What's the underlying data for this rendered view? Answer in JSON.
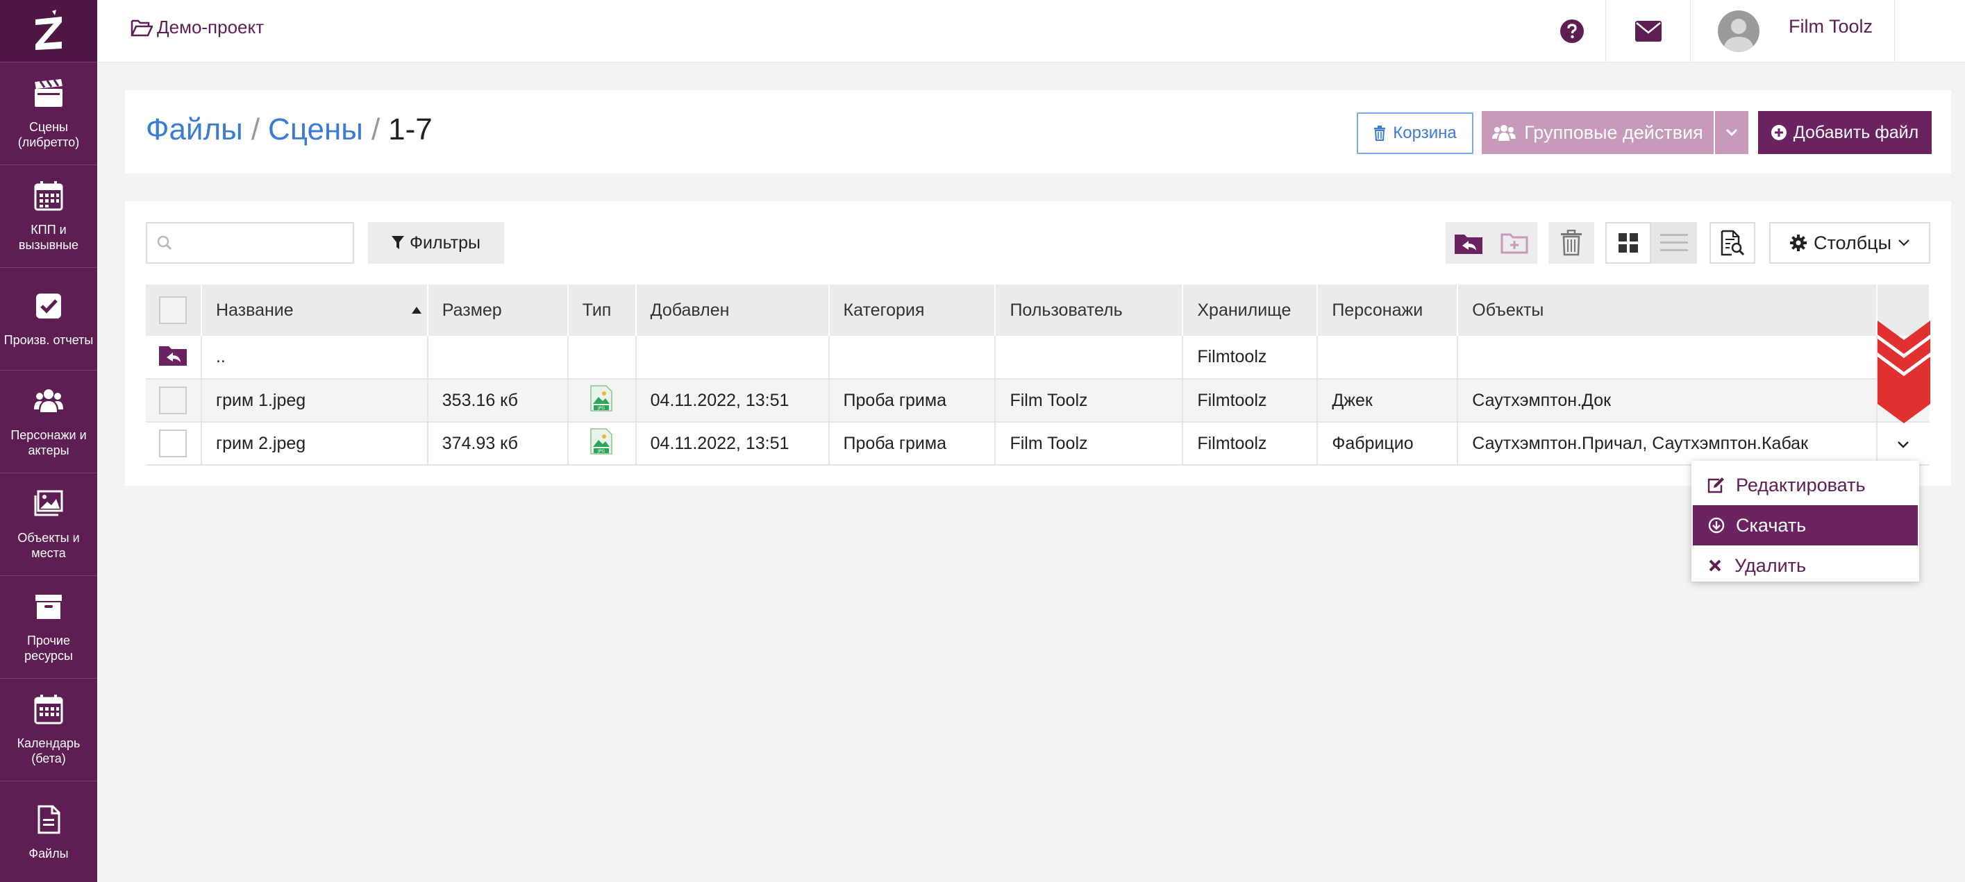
{
  "sidebar": {
    "logo": "Z",
    "items": [
      {
        "label": "Сцены\n(либретто)",
        "icon": "clapperboard-icon"
      },
      {
        "label": "КПП и\nвызывные",
        "icon": "calendar-grid-icon"
      },
      {
        "label": "Произв. отчеты",
        "icon": "checkbox-icon"
      },
      {
        "label": "Персонажи и\nактеры",
        "icon": "users-icon"
      },
      {
        "label": "Объекты и\nместа",
        "icon": "image-icon"
      },
      {
        "label": "Прочие\nресурсы",
        "icon": "archive-icon"
      },
      {
        "label": "Календарь\n(бета)",
        "icon": "calendar-icon"
      },
      {
        "label": "Файлы",
        "icon": "file-icon"
      }
    ]
  },
  "topbar": {
    "project": "Демо-проект",
    "user_name": "Film Toolz",
    "lang": "RU"
  },
  "breadcrumb": {
    "files": "Файлы",
    "scenes": "Сцены",
    "current": "1-7",
    "sep": "/"
  },
  "actions": {
    "trash": "Корзина",
    "group": "Групповые действия",
    "add": "Добавить файл"
  },
  "toolbar": {
    "search_placeholder": "",
    "filters": "Фильтры",
    "columns": "Столбцы"
  },
  "table": {
    "headers": [
      "Название",
      "Размер",
      "Тип",
      "Добавлен",
      "Категория",
      "Пользователь",
      "Хранилище",
      "Персонажи",
      "Объекты"
    ],
    "parent_row": {
      "name": "..",
      "storage": "Filmtoolz"
    },
    "rows": [
      {
        "name": "грим 1.jpeg",
        "size": "353.16 кб",
        "type": "JPG",
        "added": "04.11.2022, 13:51",
        "category": "Проба грима",
        "user": "Film Toolz",
        "storage": "Filmtoolz",
        "characters": "Джек",
        "objects": "Саутхэмптон.Док"
      },
      {
        "name": "грим 2.jpeg",
        "size": "374.93 кб",
        "type": "JPG",
        "added": "04.11.2022, 13:51",
        "category": "Проба грима",
        "user": "Film Toolz",
        "storage": "Filmtoolz",
        "characters": "Фабрицио",
        "objects": "Саутхэмптон.Причал, Саутхэмптон.Кабак"
      }
    ]
  },
  "menu": {
    "edit": "Редактировать",
    "download": "Скачать",
    "delete": "Удалить"
  },
  "colors": {
    "brand": "#5e1e54",
    "link": "#3a7bd5",
    "highlight": "#e03030"
  }
}
